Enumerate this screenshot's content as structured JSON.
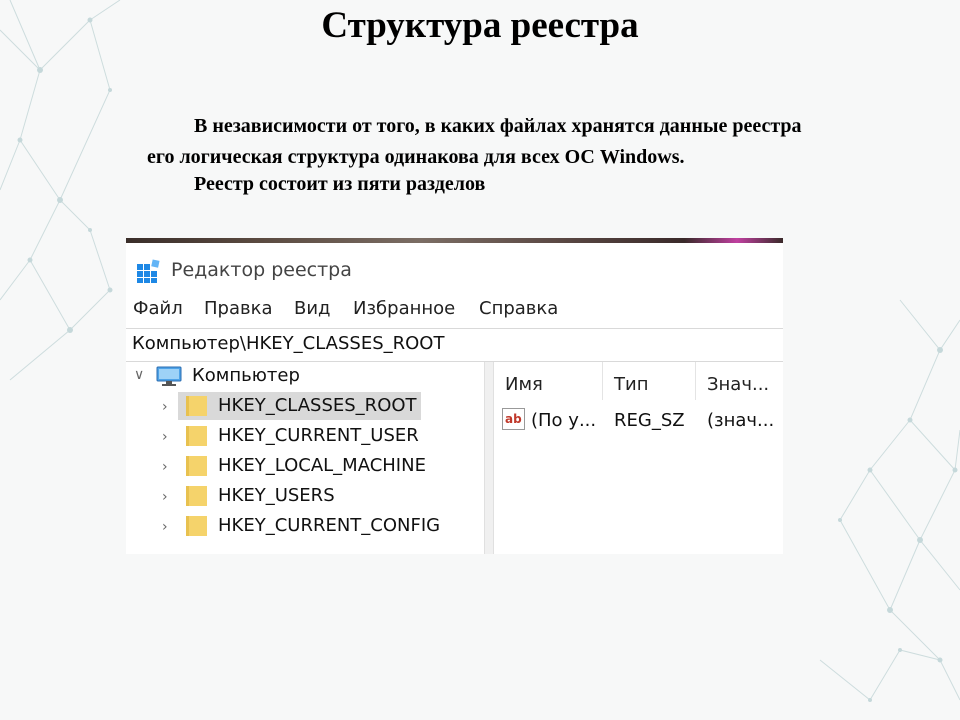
{
  "slide": {
    "title": "Структура реестра",
    "paragraph1_line1": "В независимости от того, в каких файлах хранятся данные реестра",
    "paragraph1_line2": "его логическая структура одинакова для всех ОС Windows.",
    "paragraph2": "Реестр состоит из пяти разделов"
  },
  "regedit": {
    "window_title": "Редактор реестра",
    "menu": [
      "Файл",
      "Правка",
      "Вид",
      "Избранное",
      "Справка"
    ],
    "address": "Компьютер\\HKEY_CLASSES_ROOT",
    "tree": {
      "root": "Компьютер",
      "hives": [
        "HKEY_CLASSES_ROOT",
        "HKEY_CURRENT_USER",
        "HKEY_LOCAL_MACHINE",
        "HKEY_USERS",
        "HKEY_CURRENT_CONFIG"
      ],
      "selected": "HKEY_CLASSES_ROOT"
    },
    "columns": [
      "Имя",
      "Тип",
      "Знач..."
    ],
    "rows": [
      {
        "name": "(По у...",
        "type": "REG_SZ",
        "value": "(знач..."
      }
    ]
  },
  "colors": {
    "folder": "#f5d36b",
    "selection": "#d9d9d9",
    "icon_blue": "#1e88e5",
    "ab_red": "#c0392b"
  }
}
